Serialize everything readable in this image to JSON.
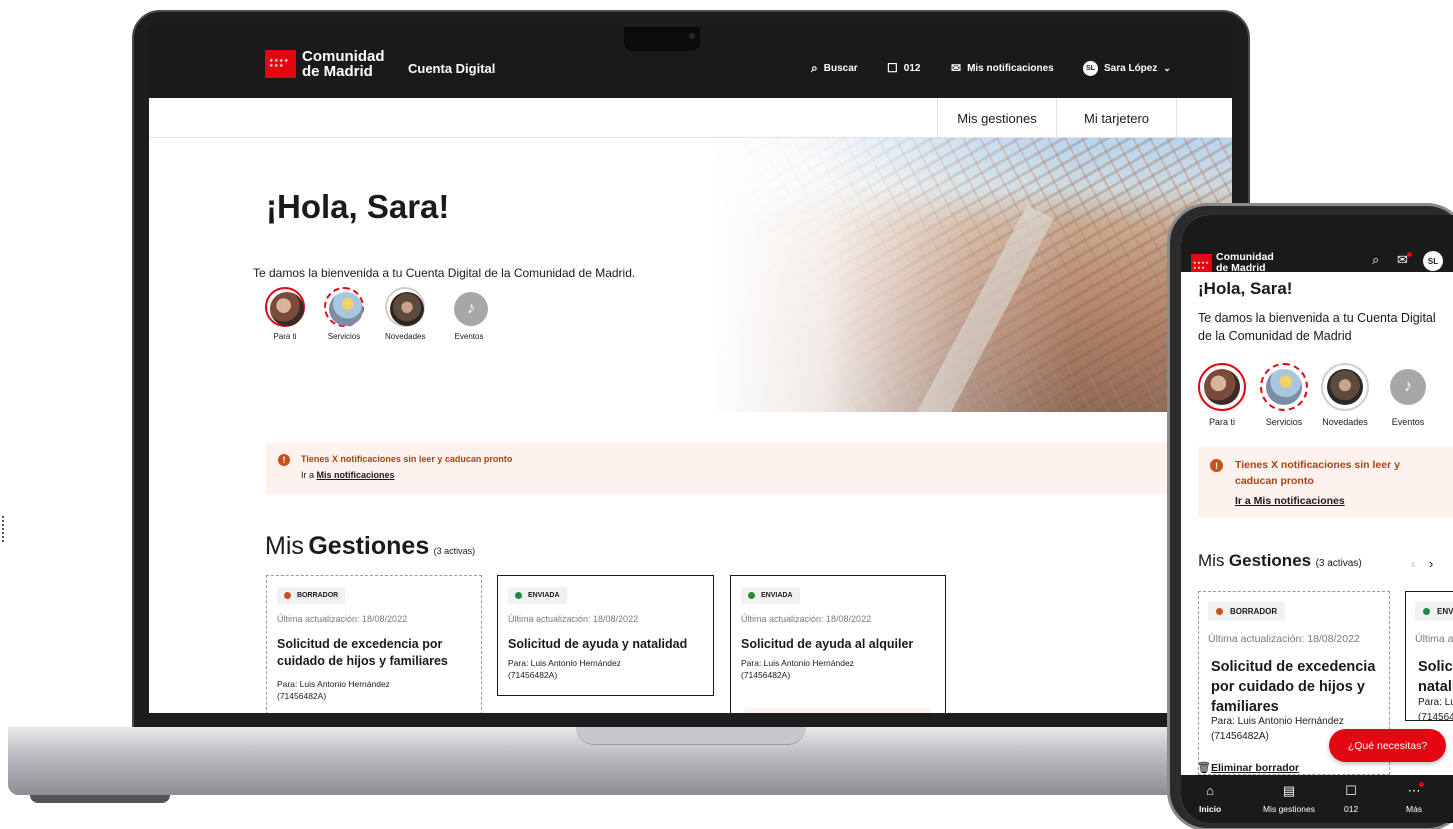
{
  "brand": {
    "name_line1": "Comunidad",
    "name_line2": "de Madrid",
    "app_name": "Cuenta Digital",
    "primary_color": "#e30613",
    "dark_color": "#1a1a1a"
  },
  "header": {
    "search_label": "Buscar",
    "search_icon": "search-icon",
    "phone_label": "012",
    "phone_icon": "chat-bubble-icon",
    "notifications_label": "Mis notificaciones",
    "notifications_icon": "envelope-icon",
    "user_initials": "SL",
    "user_name": "Sara López",
    "user_chevron": "chevron-down-icon"
  },
  "subnav": {
    "tabs": [
      {
        "label": "Mis gestiones"
      },
      {
        "label": "Mi tarjetero"
      }
    ]
  },
  "hero": {
    "greeting": "¡Hola, Sara!",
    "welcome_desktop": "Te damos la bienvenida a tu Cuenta Digital de la Comunidad de Madrid.",
    "welcome_mobile": "Te damos la bienvenida a tu Cuenta Digital de la Comunidad de Madrid"
  },
  "stories": [
    {
      "label": "Para ti",
      "state": "unseen"
    },
    {
      "label": "Servicios",
      "state": "partial"
    },
    {
      "label": "Novedades",
      "state": "seen"
    },
    {
      "label": "Eventos",
      "state": "empty",
      "icon": "music-note-icon"
    }
  ],
  "alert": {
    "title": "Tienes X notificaciones sin leer y caducan pronto",
    "link_prefix": "Ir a",
    "link_label": "Mis notificaciones",
    "mobile_link": "Ir a Mis notificaciones",
    "color": "#c8501a"
  },
  "gestiones": {
    "title_light": "Mis",
    "title_bold": "Gestiones",
    "count_label": "(3 activas)",
    "cards": [
      {
        "status": "BORRADOR",
        "status_color": "#c8501a",
        "updated": "Última actualización: 18/08/2022",
        "title": "Solicitud de excedencia por cuidado de hijos y familiares",
        "recipient": "Para: Luis Antonio Hernández (71456482A)",
        "delete_label": "Eliminar borrador"
      },
      {
        "status": "ENVIADA",
        "status_color": "#1f8a3b",
        "updated": "Última actualización: 18/08/2022",
        "title": "Solicitud de ayuda y natalidad",
        "recipient": "Para: Luis Antonio Hernández (71456482A)"
      },
      {
        "status": "ENVIADA",
        "status_color": "#1f8a3b",
        "updated": "Última actualización: 18/08/2022",
        "title": "Solicitud de ayuda al alquiler",
        "recipient": "Para: Luis Antonio Hernández (71456482A)"
      }
    ]
  },
  "mobile": {
    "help_button": "¿Qué necesitas?",
    "prev_arrow": "‹",
    "next_arrow": "›",
    "bottom_nav": [
      {
        "label": "Inicio",
        "icon": "home-icon"
      },
      {
        "label": "Mis gestiones",
        "icon": "document-list-icon"
      },
      {
        "label": "012",
        "icon": "chat-bubble-icon"
      },
      {
        "label": "Más",
        "icon": "more-dots-icon"
      }
    ]
  }
}
